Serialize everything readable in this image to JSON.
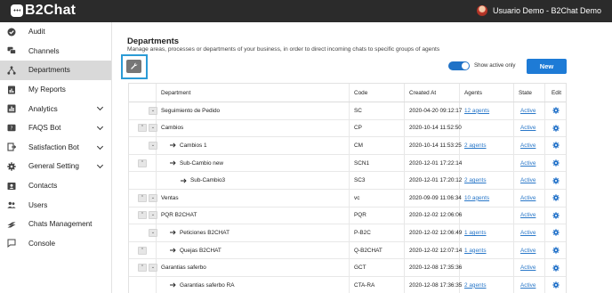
{
  "header": {
    "logo": "B2Chat",
    "user": "Usuario Demo - B2Chat Demo"
  },
  "sidebar": {
    "items": [
      {
        "label": "Audit",
        "icon": "check-circle-icon"
      },
      {
        "label": "Channels",
        "icon": "chat-bubbles-icon"
      },
      {
        "label": "Departments",
        "icon": "org-tree-icon",
        "active": true
      },
      {
        "label": "My Reports",
        "icon": "report-icon"
      },
      {
        "label": "Analytics",
        "icon": "bar-chart-icon",
        "expandable": true
      },
      {
        "label": "FAQS Bot",
        "icon": "faq-icon",
        "expandable": true
      },
      {
        "label": "Satisfaction Bot",
        "icon": "door-icon",
        "expandable": true
      },
      {
        "label": "General Setting",
        "icon": "gear-icon",
        "expandable": true
      },
      {
        "label": "Contacts",
        "icon": "contact-card-icon"
      },
      {
        "label": "Users",
        "icon": "users-icon"
      },
      {
        "label": "Chats Management",
        "icon": "layers-icon"
      },
      {
        "label": "Console",
        "icon": "console-chat-icon"
      }
    ]
  },
  "page": {
    "title": "Departments",
    "subtitle": "Manage areas, processes or departments of your business, in order to direct incoming chats to specific groups of agents",
    "toggle_label": "Show active only",
    "toggle_on": true,
    "new_button": "New"
  },
  "table": {
    "columns": [
      "Department",
      "Code",
      "Created At",
      "Agents",
      "State",
      "Edit"
    ],
    "rows": [
      {
        "controls": [
          "down"
        ],
        "depth": 0,
        "name": "Seguimiento de Pedido",
        "code": "SC",
        "created": "2020-04-20 09:12:17",
        "agents": "12 agents",
        "state": "Active"
      },
      {
        "controls": [
          "up",
          "down"
        ],
        "depth": 0,
        "name": "Cambios",
        "code": "CP",
        "created": "2020-10-14 11:52:50",
        "agents": "",
        "state": "Active"
      },
      {
        "controls": [
          "down"
        ],
        "depth": 1,
        "name": "Cambios 1",
        "code": "CM",
        "created": "2020-10-14 11:53:25",
        "agents": "2 agents",
        "state": "Active"
      },
      {
        "controls": [
          "up"
        ],
        "depth": 1,
        "name": "Sub-Cambio new",
        "code": "SCN1",
        "created": "2020-12-01 17:22:14",
        "agents": "",
        "state": "Active"
      },
      {
        "controls": [],
        "depth": 2,
        "name": "Sub-Cambio3",
        "code": "SC3",
        "created": "2020-12-01 17:20:12",
        "agents": "2 agents",
        "state": "Active"
      },
      {
        "controls": [
          "up",
          "down"
        ],
        "depth": 0,
        "name": "Ventas",
        "code": "vc",
        "created": "2020-09-09 11:06:34",
        "agents": "10 agents",
        "state": "Active"
      },
      {
        "controls": [
          "up",
          "down"
        ],
        "depth": 0,
        "name": "PQR B2CHAT",
        "code": "PQR",
        "created": "2020-12-02 12:06:06",
        "agents": "",
        "state": "Active"
      },
      {
        "controls": [
          "down"
        ],
        "depth": 1,
        "name": "Peticiones B2CHAT",
        "code": "P-B2C",
        "created": "2020-12-02 12:06:49",
        "agents": "1 agents",
        "state": "Active"
      },
      {
        "controls": [
          "up"
        ],
        "depth": 1,
        "name": "Quejas B2CHAT",
        "code": "Q-B2CHAT",
        "created": "2020-12-02 12:07:14",
        "agents": "1 agents",
        "state": "Active"
      },
      {
        "controls": [
          "up",
          "down"
        ],
        "depth": 0,
        "name": "Garantias saferbo",
        "code": "GCT",
        "created": "2020-12-08 17:35:36",
        "agents": "",
        "state": "Active"
      },
      {
        "controls": [],
        "depth": 1,
        "name": "Garantias saferbo RA",
        "code": "CTA-RA",
        "created": "2020-12-08 17:36:35",
        "agents": "2 agents",
        "state": "Active"
      }
    ]
  },
  "colors": {
    "topbar": "#2b2b2b",
    "accent": "#1e7bd6",
    "highlight": "#2b9bd6",
    "active_nav": "#d9d9d9"
  }
}
